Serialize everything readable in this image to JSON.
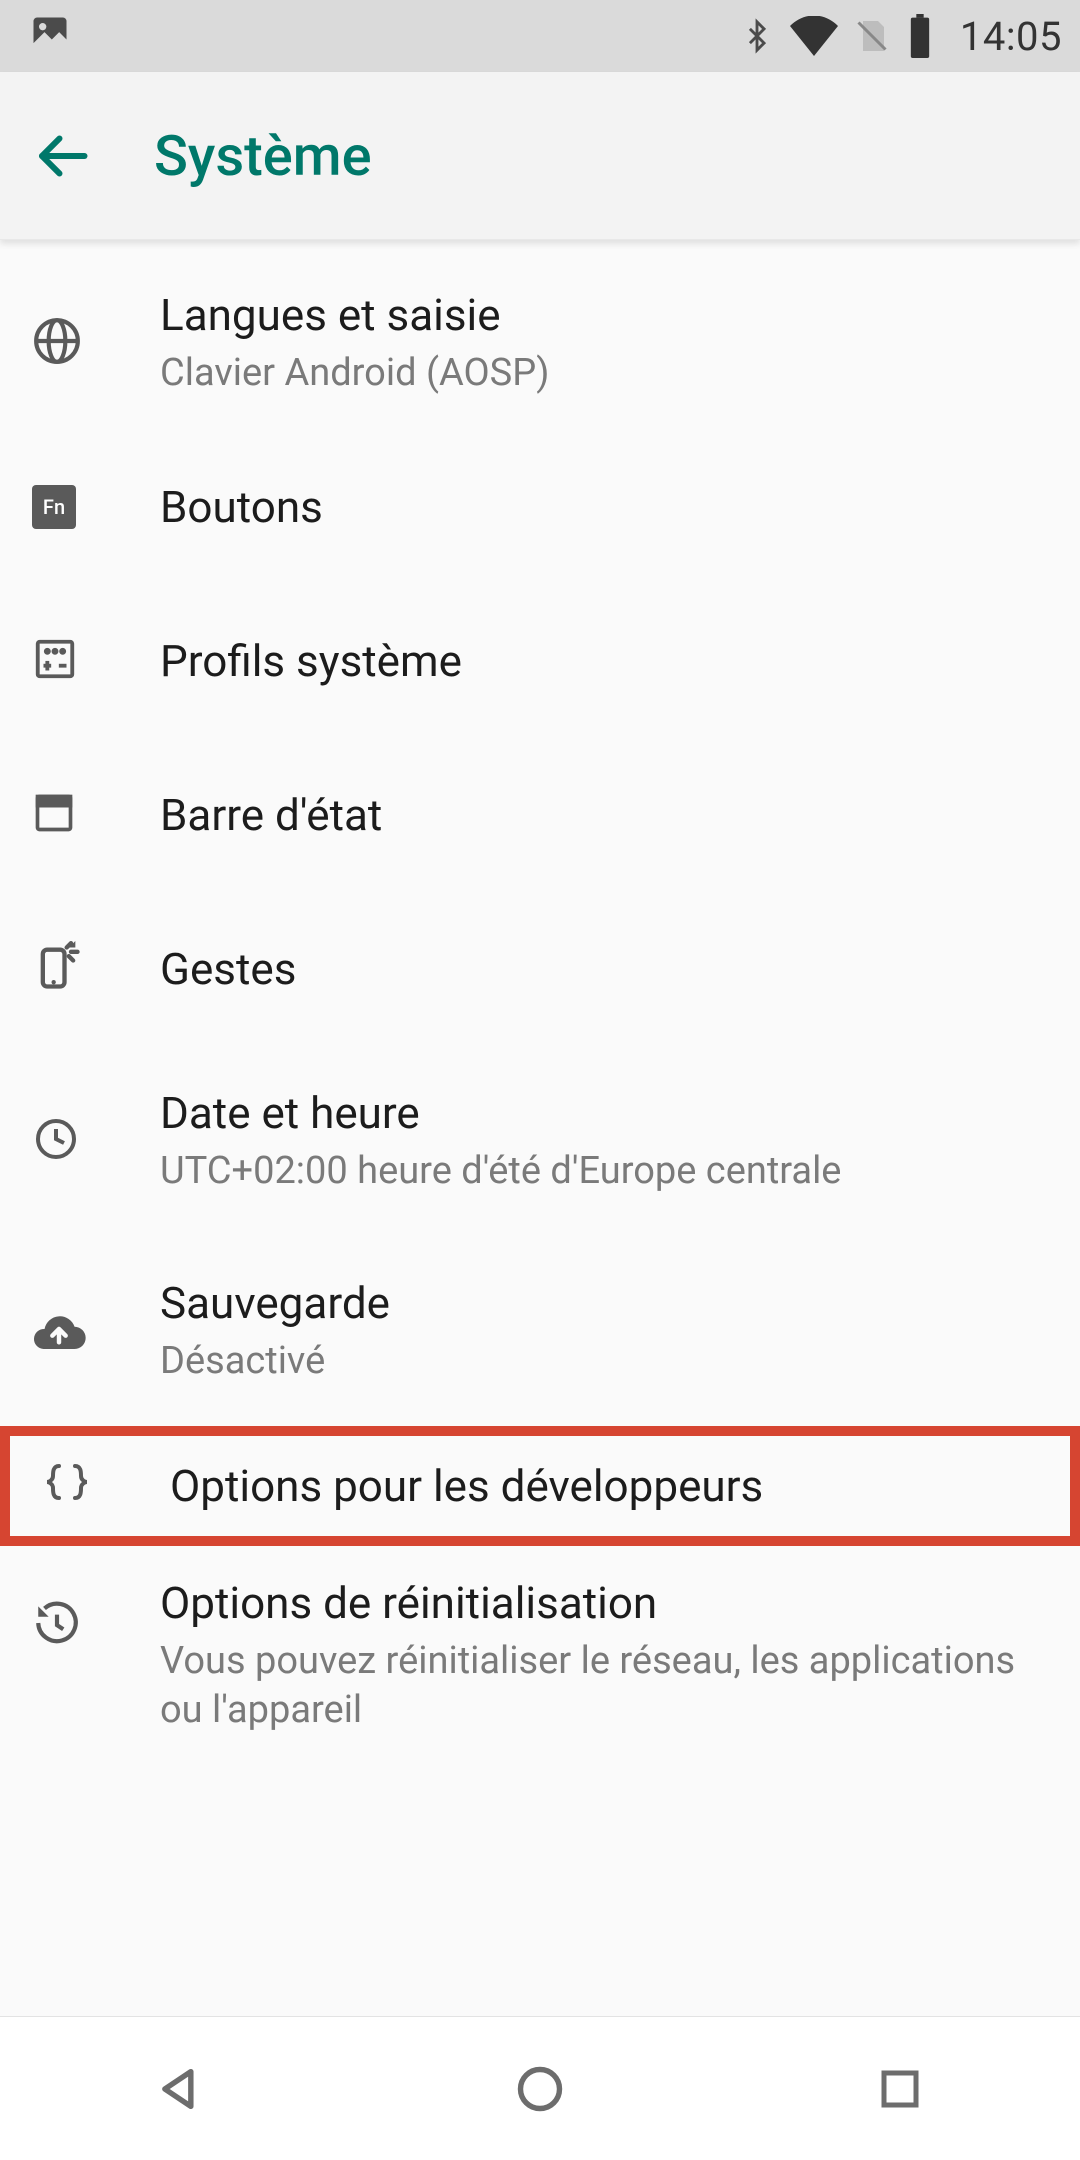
{
  "status_bar": {
    "clock": "14:05"
  },
  "header": {
    "title": "Système"
  },
  "items": [
    {
      "title": "Langues et saisie",
      "subtitle": "Clavier Android (AOSP)"
    },
    {
      "title": "Boutons"
    },
    {
      "title": "Profils système"
    },
    {
      "title": "Barre d'état"
    },
    {
      "title": "Gestes"
    },
    {
      "title": "Date et heure",
      "subtitle": "UTC+02:00 heure d'été d'Europe centrale"
    },
    {
      "title": "Sauvegarde",
      "subtitle": "Désactivé"
    },
    {
      "title": "Options pour les développeurs"
    },
    {
      "title": "Options de réinitialisation",
      "subtitle": "Vous pouvez réinitialiser le réseau, les applications ou l'appareil"
    }
  ],
  "fn_label": "Fn"
}
